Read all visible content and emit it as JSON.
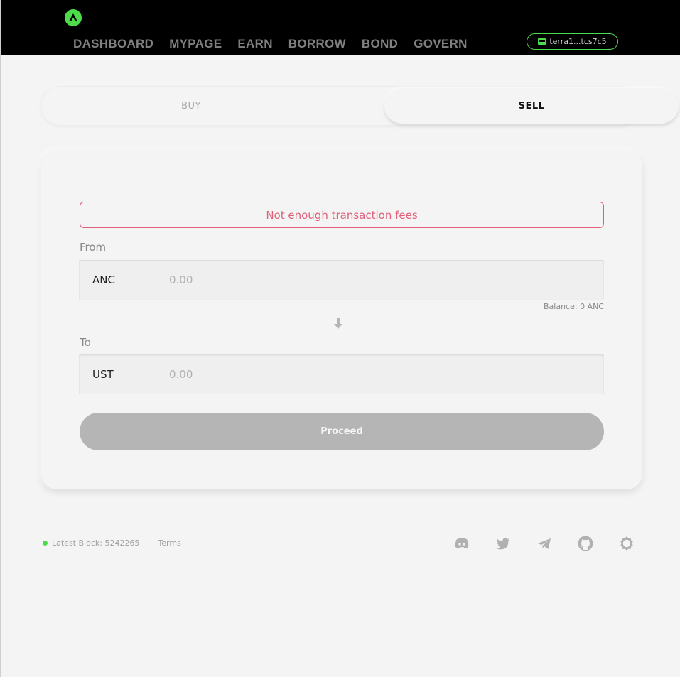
{
  "header": {
    "nav": [
      "DASHBOARD",
      "MYPAGE",
      "EARN",
      "BORROW",
      "BOND",
      "GOVERN"
    ],
    "wallet_address": "terra1...tcs7c5",
    "accent_color": "#4bdb4b"
  },
  "tabs": {
    "buy_label": "BUY",
    "sell_label": "SELL",
    "active": "SELL"
  },
  "form": {
    "error_message": "Not enough transaction fees",
    "from_label": "From",
    "from_token": "ANC",
    "from_placeholder": "0.00",
    "balance_label": "Balance:",
    "balance_value": "0 ANC",
    "to_label": "To",
    "to_token": "UST",
    "to_placeholder": "0.00",
    "proceed_label": "Proceed",
    "error_color": "#e0607a"
  },
  "footer": {
    "block_label": "Latest Block: 5242265",
    "terms_label": "Terms",
    "icons": [
      "discord-icon",
      "twitter-icon",
      "telegram-icon",
      "github-icon",
      "settings-icon"
    ]
  }
}
